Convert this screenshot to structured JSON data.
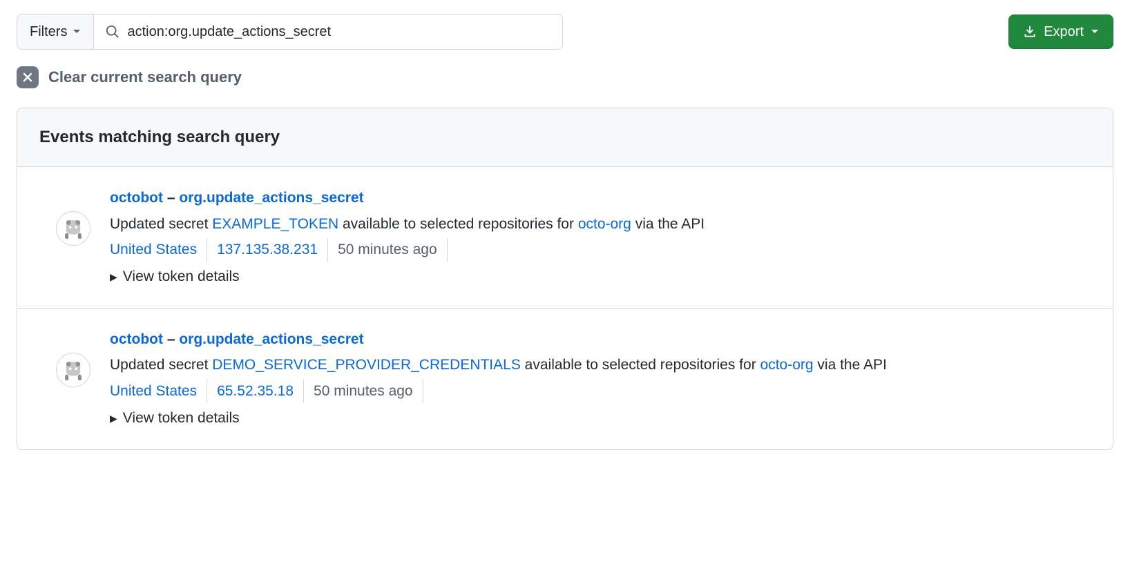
{
  "topbar": {
    "filters_label": "Filters",
    "search_value": "action:org.update_actions_secret",
    "export_label": "Export"
  },
  "clear": {
    "label": "Clear current search query"
  },
  "results": {
    "header": "Events matching search query"
  },
  "events": [
    {
      "actor": "octobot",
      "dash": " – ",
      "action": "org.update_actions_secret",
      "desc_prefix": "Updated secret ",
      "secret_name": "EXAMPLE_TOKEN",
      "desc_mid": " available to selected repositories for ",
      "org": "octo-org",
      "desc_suffix": " via the API",
      "location": "United States",
      "ip": "137.135.38.231",
      "time": "50 minutes ago",
      "details_label": "View token details"
    },
    {
      "actor": "octobot",
      "dash": " – ",
      "action": "org.update_actions_secret",
      "desc_prefix": "Updated secret ",
      "secret_name": "DEMO_SERVICE_PROVIDER_CREDENTIALS",
      "desc_mid": " available to selected repositories for ",
      "org": "octo-org",
      "desc_suffix": " via the API",
      "location": "United States",
      "ip": "65.52.35.18",
      "time": "50 minutes ago",
      "details_label": "View token details"
    }
  ]
}
